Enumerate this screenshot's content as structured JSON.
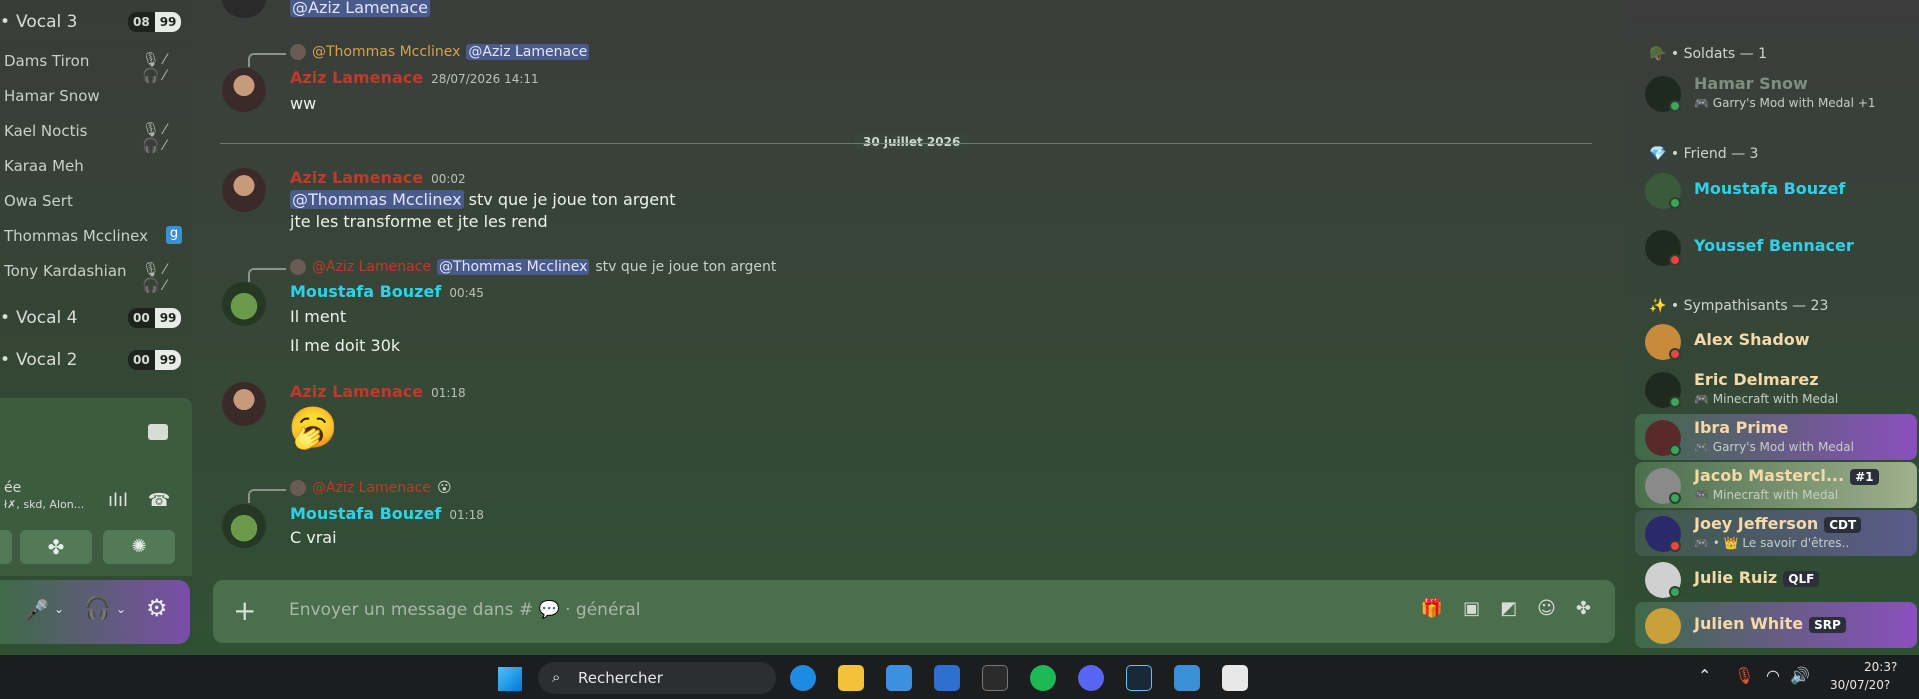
{
  "sidebar": {
    "categories": [
      {
        "label": "Vocal 3",
        "count": "08",
        "limit": "99"
      },
      {
        "label": "Vocal 4",
        "count": "00",
        "limit": "99"
      },
      {
        "label": "Vocal 2",
        "count": "00",
        "limit": "99"
      }
    ],
    "voice_users": [
      "Dams Tiron",
      "Hamar Snow",
      "Kael Noctis",
      "Karaa Meh",
      "Owa Sert",
      "Thommas Mcclinex",
      "Tony Kardashian"
    ],
    "voice_status": {
      "line1": "ée",
      "line2": "ł✗, skd, Alon..."
    }
  },
  "chat": {
    "top_mention": "@Aziz Lamenace",
    "date_divider": "30 juillet 2026",
    "messages": [
      {
        "reply_author": "@Thommas Mcclinex",
        "reply_text": "@Aziz Lamenace",
        "author": "Aziz Lamenace",
        "ts": "28/07/2026 14:11",
        "lines": [
          "ww"
        ]
      },
      {
        "author": "Aziz Lamenace",
        "ts": "00:02",
        "mention": "@Thommas Mcclinex",
        "first": " stv que je joue ton argent",
        "lines": [
          "jte les transforme et jte les rend"
        ]
      },
      {
        "reply_author": "@Aziz Lamenace",
        "reply_mention": "@Thommas Mcclinex",
        "reply_text": " stv que je joue ton argent",
        "author": "Moustafa Bouzef",
        "ts": "00:45",
        "lines": [
          "Il ment",
          "Il me doit 30k"
        ]
      },
      {
        "author": "Aziz Lamenace",
        "ts": "01:18",
        "lines": [
          "🥱"
        ]
      },
      {
        "reply_author": "@Aziz Lamenace",
        "author": "Moustafa Bouzef",
        "ts": "01:18",
        "lines": [
          "C vrai"
        ]
      }
    ]
  },
  "composer": {
    "placeholder": "Envoyer un message dans # 💬 · général"
  },
  "members": {
    "groups": [
      {
        "label": "• Soldats — 1"
      },
      {
        "label": "• Friend — 3"
      },
      {
        "label": "• Sympathisants — 23"
      }
    ],
    "list": [
      {
        "name": "Hamar Snow",
        "activity": "Garry's Mod with Medal",
        "extra": "+1",
        "color": "#7f8f7f"
      },
      {
        "name": "Moustafa Bouzef",
        "activity": "",
        "color": "#2fd0e8"
      },
      {
        "name": "Youssef Bennacer",
        "activity": "",
        "color": "#2fd0e8"
      },
      {
        "name": "Alex Shadow",
        "activity": "",
        "color": "#f5d9a8"
      },
      {
        "name": "Eric Delmarez",
        "activity": "Minecraft with Medal",
        "color": "#f5d9a8"
      },
      {
        "name": "Ibra Prime",
        "activity": "Garry's Mod with Medal",
        "color": "#f5d9a8"
      },
      {
        "name": "Jacob Mastercl...",
        "activity": "Minecraft with Medal",
        "tag": "#1",
        "color": "#f5d9a8"
      },
      {
        "name": "Joey Jefferson",
        "activity": "• 👑 Le savoir d'êtres..",
        "tag": "CDT",
        "color": "#f5d9a8"
      },
      {
        "name": "Julie Ruiz",
        "activity": "",
        "tag": "QLF",
        "color": "#f5d9a8"
      },
      {
        "name": "Julien White",
        "activity": "",
        "tag": "SRP",
        "color": "#f5d9a8"
      }
    ]
  },
  "taskbar": {
    "search": "Rechercher",
    "time": "20:3?",
    "date": "30/07/20?"
  }
}
